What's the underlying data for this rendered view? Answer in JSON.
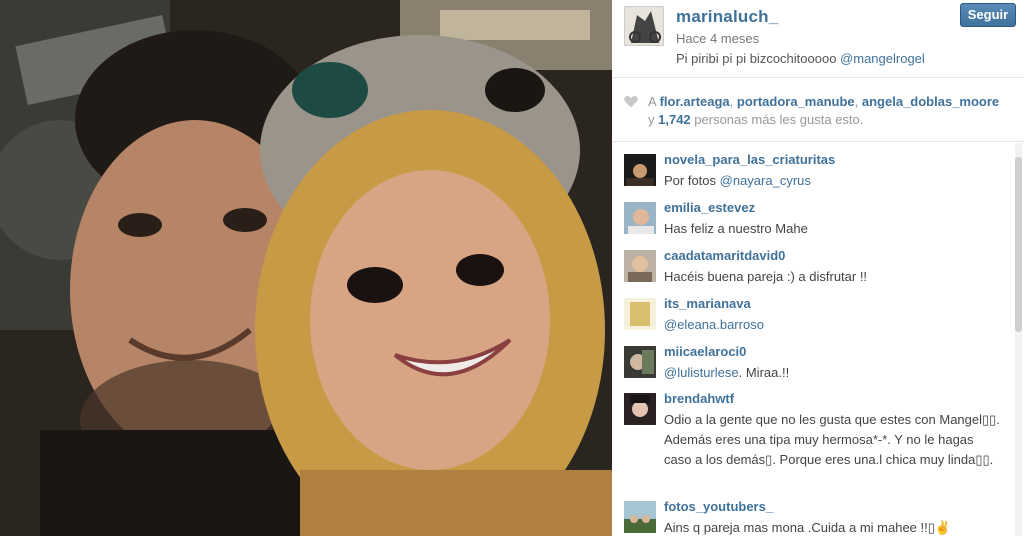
{
  "post": {
    "username": "marinaluch_",
    "time_ago": "Hace 4 meses",
    "caption_text": "Pi piribi pi pi bizcochitooooo ",
    "caption_mention": "@mangelrogel",
    "follow_label": "Seguir"
  },
  "likes": {
    "prefix": "A ",
    "users": [
      "flor.arteaga",
      "portadora_manube",
      "angela_doblas_moore"
    ],
    "separator": ", ",
    "line2_prefix": "y ",
    "count": "1,742",
    "suffix": " personas más les gusta esto."
  },
  "comments": [
    {
      "user": "novela_para_las_criaturitas",
      "mention": "",
      "text": "Por fotos ",
      "mention_after": "@nayara_cyrus"
    },
    {
      "user": "emilia_estevez",
      "text": "Has feliz a nuestro Mahe"
    },
    {
      "user": "caadatamaritdavid0",
      "text": "Hacéis buena pareja :) a disfrutar !!"
    },
    {
      "user": "its_marianava",
      "mention_after": "@eleana.barroso",
      "text": ""
    },
    {
      "user": "miicaelaroci0",
      "mention_after": "@lulisturlese",
      "text": ". Miraa.!!"
    },
    {
      "user": "brendahwtf",
      "text": "Odio a la gente que no les gusta que estes con Mangel▯▯. Además eres una tipa muy hermosa*-*. Y no le hagas caso a los demás▯. Porque eres una.l chica muy linda▯▯."
    },
    {
      "user": "fotos_youtubers_",
      "text": "Ains q pareja mas mona .Cuida a mi mahee !!▯✌"
    }
  ],
  "colors": {
    "link": "#3f729b",
    "button": "#3f729b"
  },
  "icons": {
    "heart": "heart-icon"
  }
}
